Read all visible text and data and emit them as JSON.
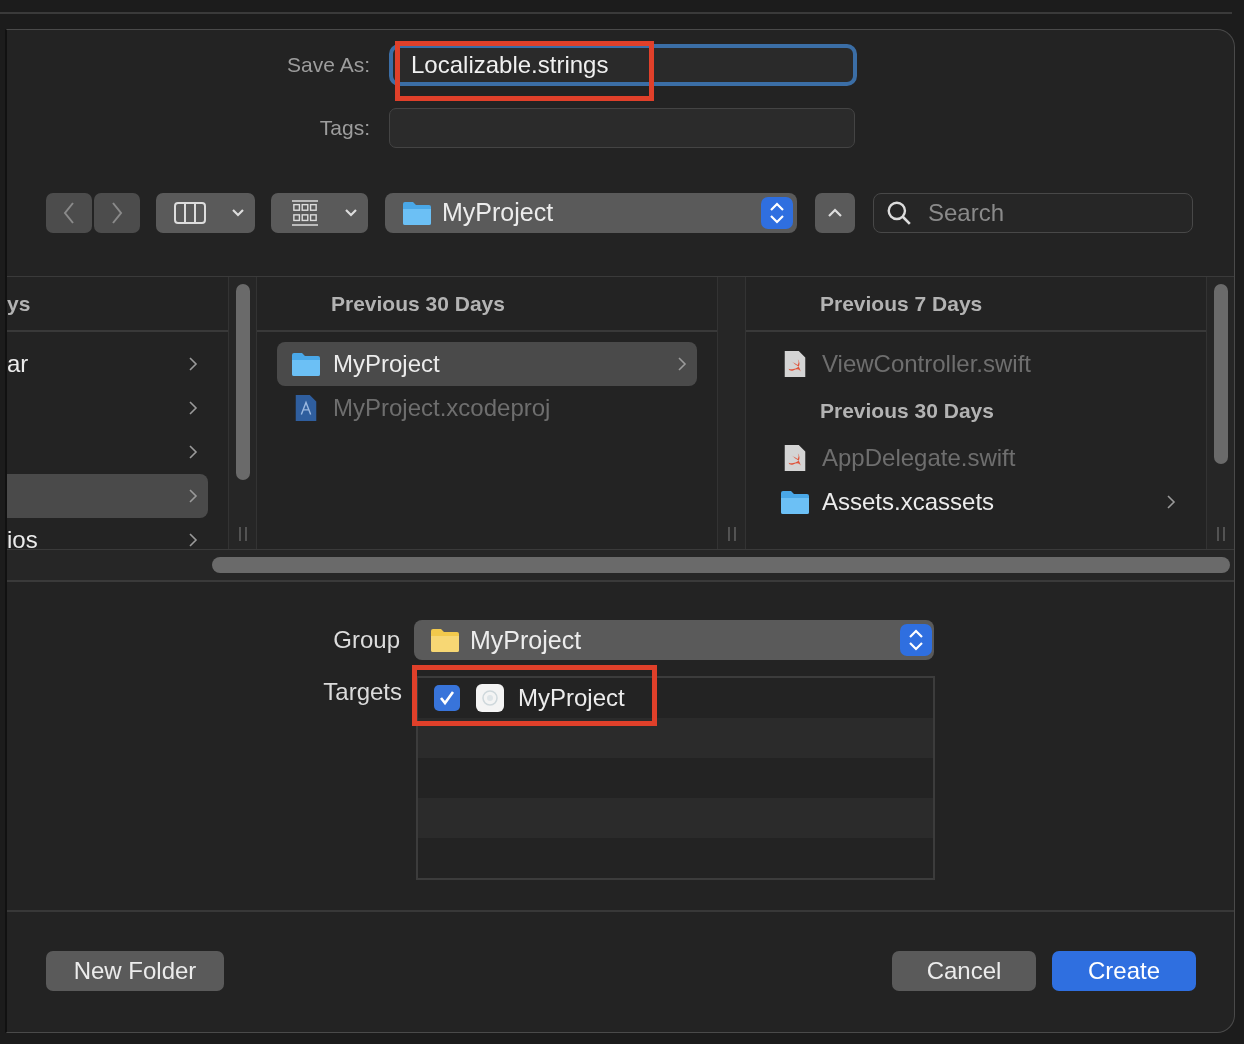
{
  "save_as": {
    "label": "Save As:",
    "value": "Localizable.strings",
    "highlighted": true
  },
  "tags": {
    "label": "Tags:"
  },
  "toolbar": {
    "location": "MyProject",
    "search": {
      "placeholder": "Search"
    }
  },
  "browser": {
    "columns": [
      {
        "header": "ys",
        "scroll_thumb": true,
        "items": [
          {
            "name": "ar",
            "kind": "plain",
            "selected": false,
            "has_children": true
          },
          {
            "kind": "plain",
            "selected": false,
            "has_children": true
          },
          {
            "kind": "plain",
            "selected": false,
            "has_children": true
          },
          {
            "kind": "plain",
            "selected": true,
            "has_children": true
          },
          {
            "name": "ios",
            "kind": "plain",
            "selected": false,
            "has_children": true
          }
        ]
      },
      {
        "header": "Previous 30 Days",
        "scroll_thumb": false,
        "items": [
          {
            "name": "MyProject",
            "kind": "folder",
            "selected": true,
            "disabled": false,
            "has_children": true
          },
          {
            "name": "MyProject.xcodeproj",
            "kind": "xcodeproj",
            "selected": false,
            "disabled": true,
            "has_children": false
          }
        ]
      },
      {
        "header": "Previous 7 Days",
        "scroll_thumb": true,
        "items": [
          {
            "name": "ViewController.swift",
            "kind": "swift",
            "selected": false,
            "disabled": true,
            "has_children": false
          },
          {
            "name": "Previous 30 Days",
            "kind": "section"
          },
          {
            "name": "AppDelegate.swift",
            "kind": "swift",
            "selected": false,
            "disabled": true,
            "has_children": false
          },
          {
            "name": "Assets.xcassets",
            "kind": "folder",
            "selected": false,
            "disabled": false,
            "has_children": true
          }
        ]
      }
    ]
  },
  "group": {
    "label": "Group",
    "value": "MyProject"
  },
  "targets": {
    "label": "Targets",
    "items": [
      {
        "name": "MyProject",
        "checked": true,
        "highlighted": true
      }
    ]
  },
  "buttons": [
    {
      "label": "New Folder",
      "kind": "normal"
    },
    {
      "label": "Cancel",
      "kind": "normal"
    },
    {
      "label": "Create",
      "kind": "default"
    }
  ]
}
